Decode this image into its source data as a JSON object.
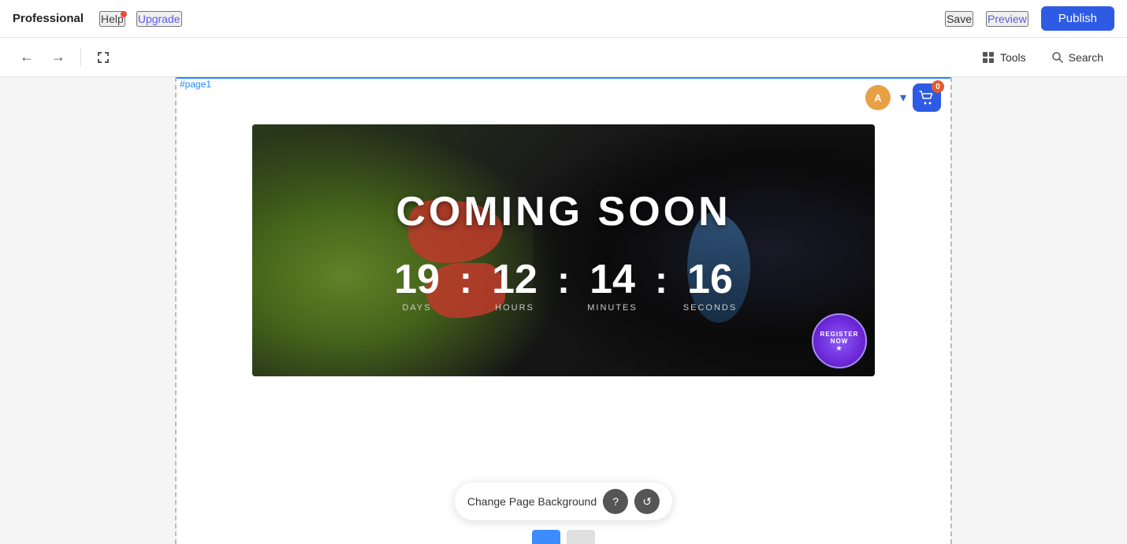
{
  "topbar": {
    "brand": "Professional",
    "help_label": "Help",
    "upgrade_label": "Upgrade",
    "save_label": "Save",
    "preview_label": "Preview",
    "publish_label": "Publish"
  },
  "toolbar": {
    "undo_label": "Undo",
    "redo_label": "Redo",
    "fit_label": "Fit",
    "tools_label": "Tools",
    "search_label": "Search"
  },
  "canvas": {
    "page_label": "#page1",
    "banner": {
      "title": "COMING SOON",
      "countdown": {
        "days_value": "19",
        "days_label": "DAYS",
        "hours_value": "12",
        "hours_label": "HOURS",
        "minutes_value": "14",
        "minutes_label": "MINUTES",
        "seconds_value": "16",
        "seconds_label": "SECONDS"
      }
    },
    "cart_badge": "0",
    "user_avatar_label": "A"
  },
  "bottom_toolbar": {
    "change_bg_label": "Change Page Background",
    "help_icon": "?",
    "refresh_icon": "↺"
  }
}
